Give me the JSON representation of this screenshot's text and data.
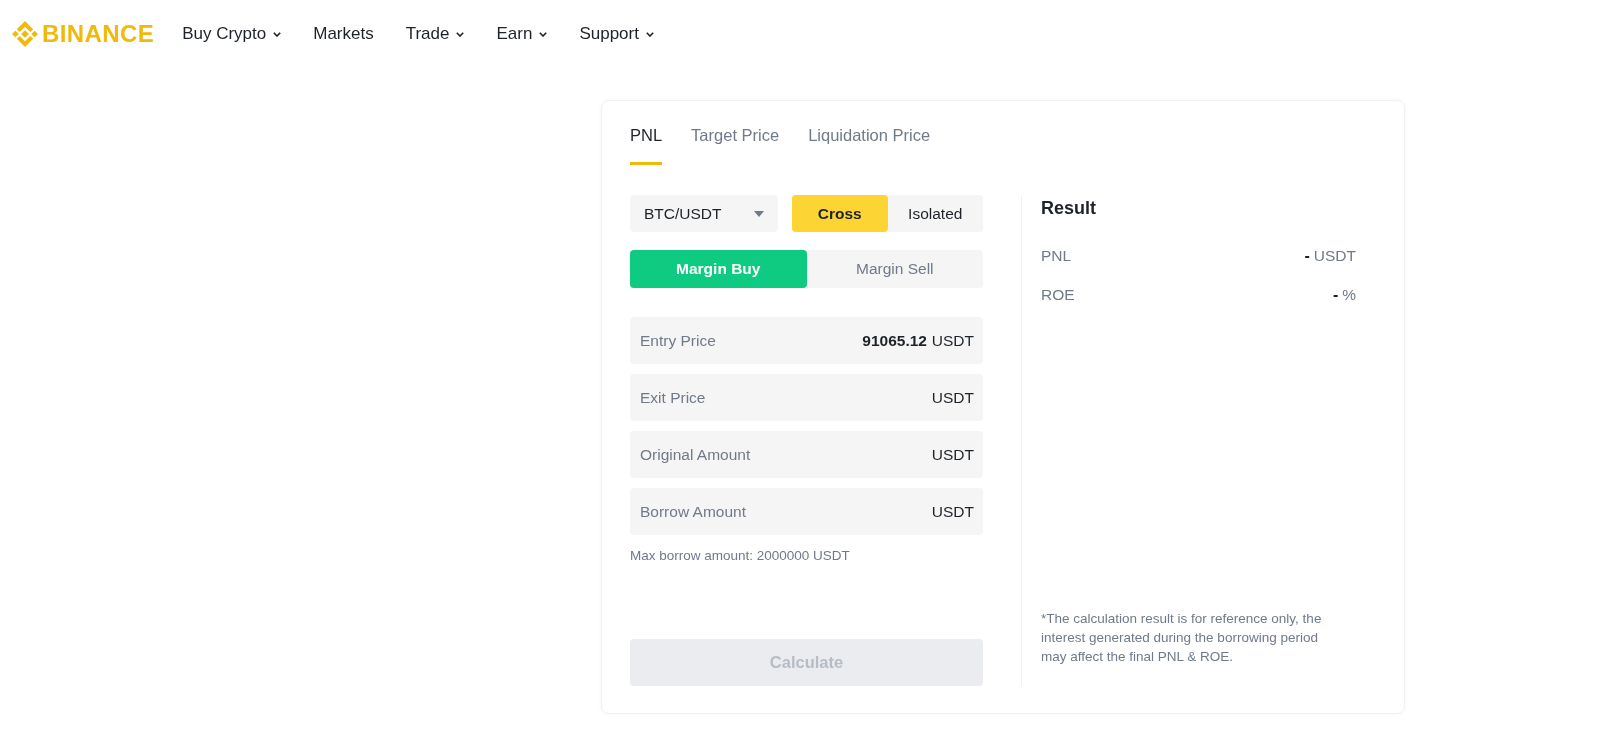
{
  "header": {
    "brand": "BINANCE",
    "nav": [
      {
        "label": "Buy Crypto",
        "has_menu": true
      },
      {
        "label": "Markets",
        "has_menu": false
      },
      {
        "label": "Trade",
        "has_menu": true
      },
      {
        "label": "Earn",
        "has_menu": true
      },
      {
        "label": "Support",
        "has_menu": true
      }
    ]
  },
  "calculator": {
    "tabs": [
      {
        "label": "PNL",
        "selected": true
      },
      {
        "label": "Target Price",
        "selected": false
      },
      {
        "label": "Liquidation Price",
        "selected": false
      }
    ],
    "pair_select": {
      "value": "BTC/USDT"
    },
    "margin_mode": [
      {
        "label": "Cross",
        "selected": true
      },
      {
        "label": "Isolated",
        "selected": false
      }
    ],
    "side": [
      {
        "label": "Margin Buy",
        "selected": true
      },
      {
        "label": "Margin Sell",
        "selected": false
      }
    ],
    "fields": [
      {
        "label": "Entry Price",
        "value": "91065.12",
        "unit": "USDT"
      },
      {
        "label": "Exit Price",
        "unit": "USDT"
      },
      {
        "label": "Original Amount",
        "unit": "USDT"
      },
      {
        "label": "Borrow Amount",
        "unit": "USDT"
      }
    ],
    "hint": "Max borrow amount: 2000000 USDT",
    "calculate_button": {
      "label": "Calculate",
      "disabled": true
    }
  },
  "result": {
    "title": "Result",
    "rows": [
      {
        "label": "PNL",
        "value": "-",
        "unit": "USDT"
      },
      {
        "label": "ROE",
        "value": "-",
        "unit": "%"
      }
    ],
    "note": "*The calculation result is for reference only, the interest generated during the borrowing period may affect the final PNL & ROE."
  }
}
